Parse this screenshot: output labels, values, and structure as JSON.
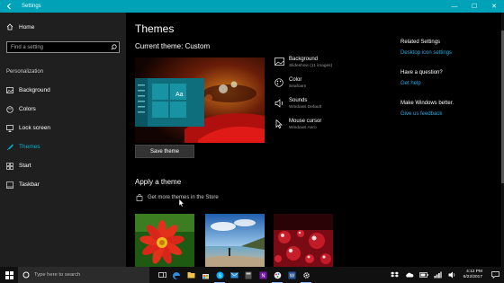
{
  "window": {
    "title": "Settings",
    "controls": [
      "—",
      "☐",
      "✕"
    ]
  },
  "sidebar": {
    "home_label": "Home",
    "search_placeholder": "Find a setting",
    "section": "Personalization",
    "items": [
      {
        "label": "Background",
        "icon": "picture-icon"
      },
      {
        "label": "Colors",
        "icon": "palette-icon"
      },
      {
        "label": "Lock screen",
        "icon": "monitor-icon"
      },
      {
        "label": "Themes",
        "icon": "brush-icon",
        "active": true
      },
      {
        "label": "Start",
        "icon": "start-grid-icon"
      },
      {
        "label": "Taskbar",
        "icon": "taskbar-icon"
      }
    ]
  },
  "main": {
    "title": "Themes",
    "current_theme": "Current theme: Custom",
    "preview_tile_label": "Aa",
    "save_button": "Save theme",
    "properties": [
      {
        "title": "Background",
        "subtitle": "Slideshow (11 images)",
        "icon": "picture-icon"
      },
      {
        "title": "Color",
        "subtitle": "Seafoam",
        "icon": "palette-icon"
      },
      {
        "title": "Sounds",
        "subtitle": "Windows Default",
        "icon": "speaker-icon"
      },
      {
        "title": "Mouse cursor",
        "subtitle": "Windows Aero",
        "icon": "cursor-icon"
      }
    ],
    "apply_title": "Apply a theme",
    "store_link": "Get more themes in the Store"
  },
  "related": {
    "heading": "Related Settings",
    "link": "Desktop icon settings",
    "question": "Have a question?",
    "help_link": "Get help",
    "better": "Make Windows better.",
    "feedback_link": "Give us feedback"
  },
  "taskbar": {
    "search_placeholder": "Type here to search",
    "time": "4:12 PM",
    "date": "6/22/2017"
  },
  "colors": {
    "accent": "#00a2b8",
    "link": "#2aa9e0",
    "active_nav": "#00b4d2"
  }
}
